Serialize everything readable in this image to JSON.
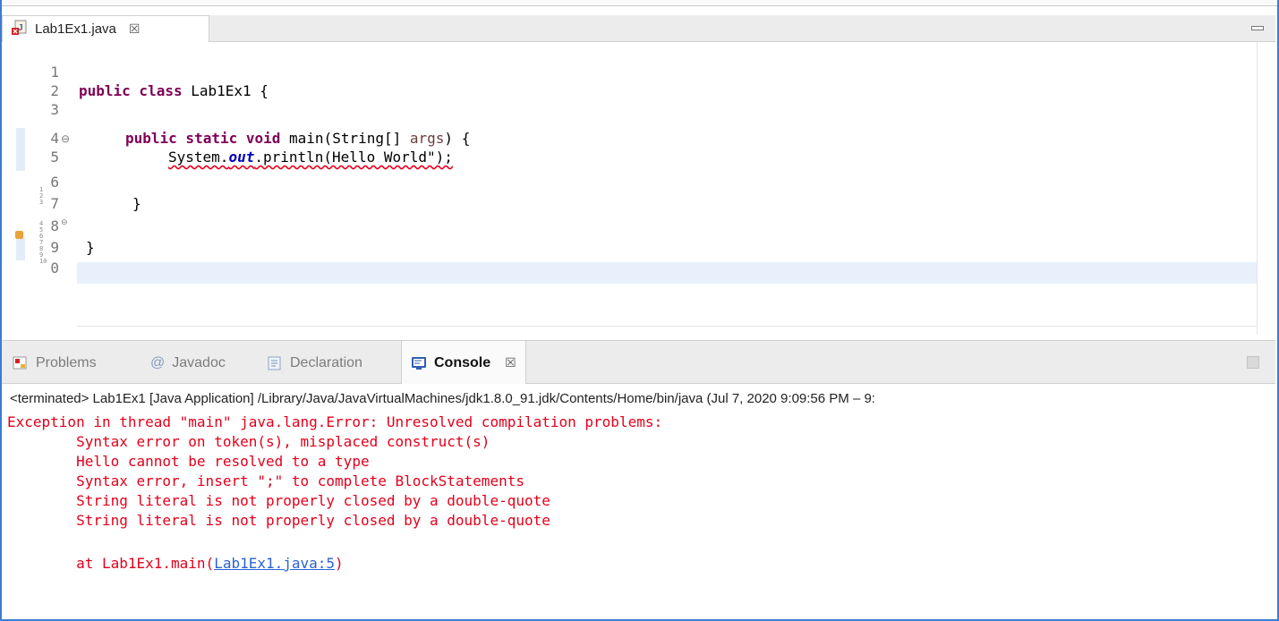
{
  "editor": {
    "tab_label": "Lab1Ex1.java",
    "tab_close_glyph": "☒",
    "file_icon": "java-file-error-icon",
    "line_numbers": [
      "1",
      "2",
      "3",
      "4",
      "5",
      "6",
      "7",
      "8",
      "9",
      "0"
    ],
    "fold_glyph_4": "⊖",
    "fold_glyph_8": "⊖",
    "code": {
      "l2_kw": "public class",
      "l2_rest": " Lab1Ex1 {",
      "l4_kw": "public static void",
      "l4_mid": " main(String[] ",
      "l4_param": "args",
      "l4_end": ") {",
      "l5_a": "System.",
      "l5_field": "out",
      "l5_b": ".println(Hello World\");",
      "l7": "}",
      "l9": "}"
    }
  },
  "console": {
    "tabs": [
      {
        "label": "Problems",
        "icon": "problems-icon"
      },
      {
        "label": "Javadoc",
        "icon": "at-icon"
      },
      {
        "label": "Declaration",
        "icon": "declaration-icon"
      },
      {
        "label": "Console",
        "icon": "console-icon"
      }
    ],
    "close_glyph": "☒",
    "terminated_line": "<terminated> Lab1Ex1 [Java Application] /Library/Java/JavaVirtualMachines/jdk1.8.0_91.jdk/Contents/Home/bin/java  (Jul 7, 2020 9:09:56 PM – 9:",
    "output": [
      "Exception in thread \"main\" java.lang.Error: Unresolved compilation problems:",
      "\tSyntax error on token(s), misplaced construct(s)",
      "\tHello cannot be resolved to a type",
      "\tSyntax error, insert \";\" to complete BlockStatements",
      "\tString literal is not properly closed by a double-quote",
      "\tString literal is not properly closed by a double-quote"
    ],
    "stack_prefix": "\tat Lab1Ex1.main(",
    "stack_link": "Lab1Ex1.java:5",
    "stack_suffix": ")"
  },
  "colors": {
    "keyword": "#7f0055",
    "error_text": "#e3001b",
    "link": "#2a62d8",
    "frame_accent": "#3c7bd6"
  }
}
